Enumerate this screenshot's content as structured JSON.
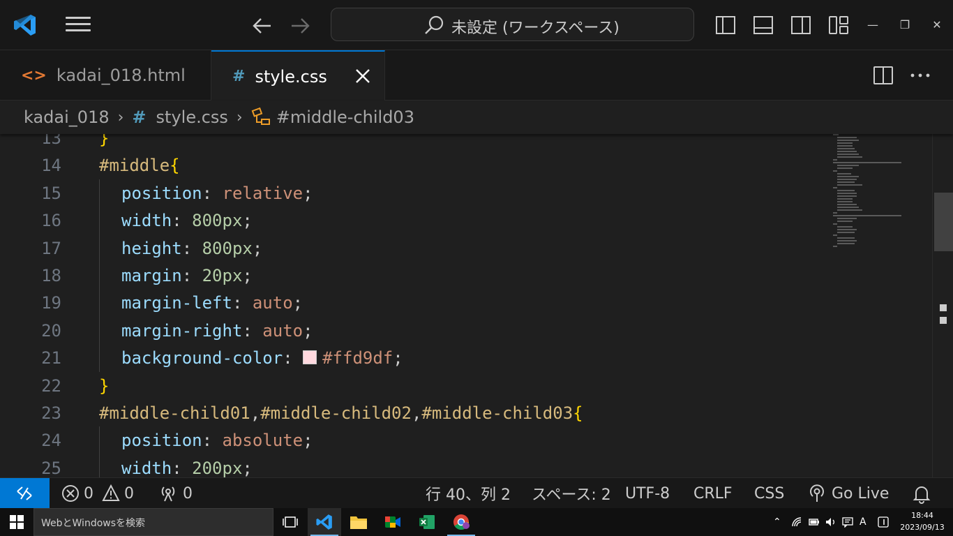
{
  "titlebar": {
    "search_text": "未設定 (ワークスペース)"
  },
  "tabs": [
    {
      "label": "kadai_018.html",
      "icon": "html-file-icon"
    },
    {
      "label": "style.css",
      "icon": "css-file-icon"
    }
  ],
  "breadcrumb": {
    "folder": "kadai_018",
    "file": "style.css",
    "symbol": "#middle-child03"
  },
  "editor": {
    "lines": [
      {
        "n": "13",
        "indent": 0,
        "tokens": [
          {
            "t": "brace",
            "v": "}"
          }
        ]
      },
      {
        "n": "14",
        "indent": 0,
        "tokens": [
          {
            "t": "sel",
            "v": "#middle"
          },
          {
            "t": "brace",
            "v": "{"
          }
        ]
      },
      {
        "n": "15",
        "indent": 1,
        "tokens": [
          {
            "t": "prop",
            "v": "position"
          },
          {
            "t": "punc",
            "v": ": "
          },
          {
            "t": "val",
            "v": "relative"
          },
          {
            "t": "punc",
            "v": ";"
          }
        ]
      },
      {
        "n": "16",
        "indent": 1,
        "tokens": [
          {
            "t": "prop",
            "v": "width"
          },
          {
            "t": "punc",
            "v": ": "
          },
          {
            "t": "num",
            "v": "800px"
          },
          {
            "t": "punc",
            "v": ";"
          }
        ]
      },
      {
        "n": "17",
        "indent": 1,
        "tokens": [
          {
            "t": "prop",
            "v": "height"
          },
          {
            "t": "punc",
            "v": ": "
          },
          {
            "t": "num",
            "v": "800px"
          },
          {
            "t": "punc",
            "v": ";"
          }
        ]
      },
      {
        "n": "18",
        "indent": 1,
        "tokens": [
          {
            "t": "prop",
            "v": "margin"
          },
          {
            "t": "punc",
            "v": ": "
          },
          {
            "t": "num",
            "v": "20px"
          },
          {
            "t": "punc",
            "v": ";"
          }
        ]
      },
      {
        "n": "19",
        "indent": 1,
        "tokens": [
          {
            "t": "prop",
            "v": "margin-left"
          },
          {
            "t": "punc",
            "v": ": "
          },
          {
            "t": "val",
            "v": "auto"
          },
          {
            "t": "punc",
            "v": ";"
          }
        ]
      },
      {
        "n": "20",
        "indent": 1,
        "tokens": [
          {
            "t": "prop",
            "v": "margin-right"
          },
          {
            "t": "punc",
            "v": ": "
          },
          {
            "t": "val",
            "v": "auto"
          },
          {
            "t": "punc",
            "v": ";"
          }
        ]
      },
      {
        "n": "21",
        "indent": 1,
        "tokens": [
          {
            "t": "prop",
            "v": "background-color"
          },
          {
            "t": "punc",
            "v": ": "
          },
          {
            "t": "swatch",
            "v": "#ffd9df"
          },
          {
            "t": "val",
            "v": "#ffd9df"
          },
          {
            "t": "punc",
            "v": ";"
          }
        ]
      },
      {
        "n": "22",
        "indent": 0,
        "tokens": [
          {
            "t": "brace",
            "v": "}"
          }
        ]
      },
      {
        "n": "23",
        "indent": 0,
        "tokens": [
          {
            "t": "sel",
            "v": "#middle-child01"
          },
          {
            "t": "punc",
            "v": ","
          },
          {
            "t": "sel",
            "v": "#middle-child02"
          },
          {
            "t": "punc",
            "v": ","
          },
          {
            "t": "sel",
            "v": "#middle-child03"
          },
          {
            "t": "brace",
            "v": "{"
          }
        ]
      },
      {
        "n": "24",
        "indent": 1,
        "tokens": [
          {
            "t": "prop",
            "v": "position"
          },
          {
            "t": "punc",
            "v": ": "
          },
          {
            "t": "val",
            "v": "absolute"
          },
          {
            "t": "punc",
            "v": ";"
          }
        ]
      },
      {
        "n": "25",
        "indent": 1,
        "tokens": [
          {
            "t": "prop",
            "v": "width"
          },
          {
            "t": "punc",
            "v": ": "
          },
          {
            "t": "num",
            "v": "200px"
          },
          {
            "t": "punc",
            "v": ";"
          }
        ]
      }
    ]
  },
  "statusbar": {
    "errors": "0",
    "warnings": "0",
    "ports": "0",
    "position": "行 40、列 2",
    "spaces": "スペース: 2",
    "encoding": "UTF-8",
    "eol": "CRLF",
    "language": "CSS",
    "golive": "Go Live"
  },
  "taskbar": {
    "search_placeholder": "WebとWindowsを検索",
    "ime": "A",
    "time": "18:44",
    "date": "2023/09/13"
  },
  "colors": {
    "accent": "#0078d4",
    "editor_bg": "#1f1f1f",
    "swatch": "#ffd9df"
  }
}
